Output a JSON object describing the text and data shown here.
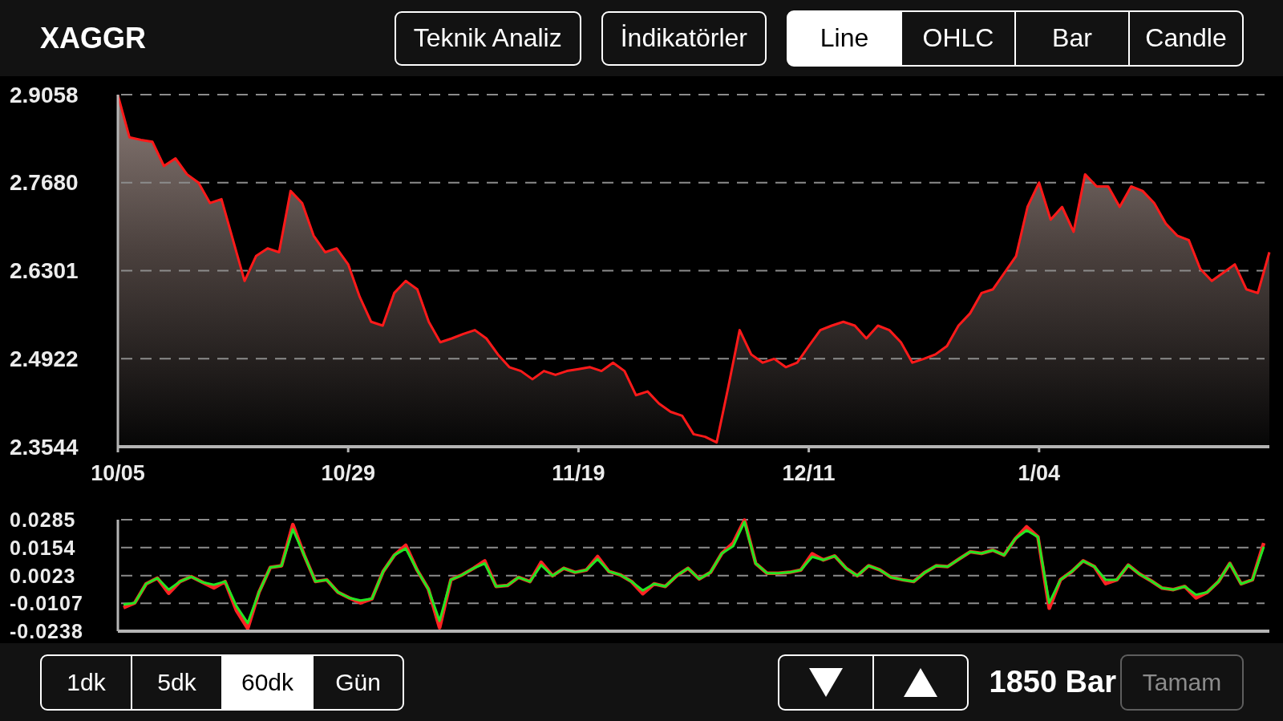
{
  "header": {
    "symbol": "XAGGR",
    "buttons": [
      "Teknik Analiz",
      "İndikatörler"
    ],
    "chart_types": [
      {
        "label": "Line",
        "selected": true
      },
      {
        "label": "OHLC",
        "selected": false
      },
      {
        "label": "Bar",
        "selected": false
      },
      {
        "label": "Candle",
        "selected": false
      }
    ]
  },
  "price_chart": {
    "chart_data": {
      "type": "area",
      "grid": true,
      "categories": [
        "10/05",
        null,
        null,
        null,
        null,
        null,
        null,
        null,
        null,
        null,
        null,
        null,
        null,
        null,
        null,
        null,
        null,
        null,
        null,
        null,
        "10/29",
        null,
        null,
        null,
        null,
        null,
        null,
        null,
        null,
        null,
        null,
        null,
        null,
        null,
        null,
        null,
        null,
        null,
        null,
        null,
        "11/19",
        null,
        null,
        null,
        null,
        null,
        null,
        null,
        null,
        null,
        null,
        null,
        null,
        null,
        null,
        null,
        null,
        null,
        null,
        null,
        "12/11",
        null,
        null,
        null,
        null,
        null,
        null,
        null,
        null,
        null,
        null,
        null,
        null,
        null,
        null,
        null,
        null,
        null,
        null,
        null,
        "1/04",
        null,
        null,
        null,
        null,
        null,
        null,
        null,
        null,
        null,
        null,
        null,
        null,
        null,
        null,
        null,
        null,
        null,
        null,
        null,
        null
      ],
      "ylim": [
        2.3544,
        2.9058
      ],
      "yticks": [
        2.9058,
        {
          "value": 2.768,
          "label": "2.7680"
        },
        2.6301,
        2.4922,
        2.3544
      ],
      "series": [
        {
          "color": "#ff1a1a",
          "values": [
            2.905,
            2.839,
            2.835,
            2.832,
            2.794,
            2.806,
            2.781,
            2.768,
            2.736,
            2.742,
            2.678,
            2.614,
            2.653,
            2.665,
            2.659,
            2.755,
            2.736,
            2.685,
            2.659,
            2.665,
            2.64,
            2.589,
            2.55,
            2.544,
            2.595,
            2.614,
            2.601,
            2.55,
            2.518,
            2.524,
            2.531,
            2.537,
            2.524,
            2.499,
            2.479,
            2.473,
            2.46,
            2.473,
            2.467,
            2.473,
            2.476,
            2.479,
            2.473,
            2.486,
            2.473,
            2.435,
            2.441,
            2.422,
            2.409,
            2.403,
            2.374,
            2.37,
            2.361,
            2.447,
            2.537,
            2.499,
            2.486,
            2.492,
            2.479,
            2.486,
            2.512,
            2.537,
            2.544,
            2.55,
            2.544,
            2.524,
            2.544,
            2.537,
            2.518,
            2.486,
            2.492,
            2.499,
            2.512,
            2.544,
            2.563,
            2.595,
            2.601,
            2.627,
            2.653,
            2.73,
            2.768,
            2.71,
            2.73,
            2.691,
            2.781,
            2.762,
            2.762,
            2.73,
            2.762,
            2.755,
            2.736,
            2.704,
            2.685,
            2.678,
            2.633,
            2.614,
            2.627,
            2.64,
            2.601,
            2.595,
            2.659
          ]
        }
      ]
    }
  },
  "indicator_chart": {
    "chart_data": {
      "type": "line",
      "grid": true,
      "categories": [
        null,
        null,
        null,
        null,
        null,
        null,
        null,
        null,
        null,
        null,
        null,
        null,
        null,
        null,
        null,
        null,
        null,
        null,
        null,
        null,
        null,
        null,
        null,
        null,
        null,
        null,
        null,
        null,
        null,
        null,
        null,
        null,
        null,
        null,
        null,
        null,
        null,
        null,
        null,
        null,
        null,
        null,
        null,
        null,
        null,
        null,
        null,
        null,
        null,
        null,
        null,
        null,
        null,
        null,
        null,
        null,
        null,
        null,
        null,
        null,
        null,
        null,
        null,
        null,
        null,
        null,
        null,
        null,
        null,
        null,
        null,
        null,
        null,
        null,
        null,
        null,
        null,
        null,
        null,
        null,
        null,
        null,
        null,
        null,
        null,
        null,
        null,
        null,
        null,
        null,
        null,
        null,
        null,
        null,
        null,
        null,
        null,
        null,
        null,
        null,
        null,
        null
      ],
      "ylim": [
        -0.0238,
        0.0285
      ],
      "yticks": [
        0.0285,
        0.0154,
        0.0023,
        -0.0107,
        -0.0238
      ],
      "series": [
        {
          "color": "#ff2424",
          "values": [
            -0.0128,
            -0.0105,
            -0.0016,
            0.0011,
            -0.006,
            -0.0005,
            0.0018,
            -0.0009,
            -0.0035,
            -0.0005,
            -0.014,
            -0.0225,
            -0.0055,
            0.0061,
            0.0069,
            0.0262,
            0.0119,
            -0.0005,
            0.0003,
            -0.0055,
            -0.0082,
            -0.0105,
            -0.0086,
            0.0042,
            0.0119,
            0.0165,
            0.0049,
            -0.004,
            -0.0222,
            0.0003,
            0.0026,
            0.0057,
            0.0092,
            -0.0028,
            -0.0024,
            0.0015,
            -0.0005,
            0.0085,
            0.0022,
            0.0057,
            0.0038,
            0.0049,
            0.0112,
            0.0042,
            0.0026,
            -0.0005,
            -0.0062,
            -0.0016,
            -0.0028,
            0.0022,
            0.0057,
            0.0007,
            0.0038,
            0.0127,
            0.0175,
            0.0283,
            0.008,
            0.0034,
            0.0034,
            0.0038,
            0.0049,
            0.0125,
            0.0096,
            0.0115,
            0.0057,
            0.0022,
            0.0069,
            0.0049,
            0.0015,
            0.0003,
            -0.0005,
            0.0038,
            0.0069,
            0.0065,
            0.01,
            0.0134,
            0.0127,
            0.0142,
            0.0119,
            0.0196,
            0.0252,
            0.0204,
            -0.013,
            0.0003,
            0.0042,
            0.0092,
            0.0065,
            -0.0015,
            0.0003,
            0.0072,
            0.003,
            -0.0001,
            -0.0036,
            -0.0043,
            -0.0028,
            -0.0082,
            -0.0055,
            -0.0005,
            0.008,
            -0.0016,
            0.0003,
            0.0175
          ]
        },
        {
          "color": "#22e622",
          "values": [
            -0.0113,
            -0.0105,
            -0.0016,
            0.0011,
            -0.0043,
            -0.0005,
            0.0018,
            -0.0009,
            -0.002,
            -0.0005,
            -0.012,
            -0.02,
            -0.0055,
            0.0061,
            0.0069,
            0.024,
            0.0119,
            -0.0005,
            0.0003,
            -0.0055,
            -0.0082,
            -0.0094,
            -0.0086,
            0.0042,
            0.0119,
            0.015,
            0.0049,
            -0.004,
            -0.019,
            0.0003,
            0.0026,
            0.0057,
            0.008,
            -0.0028,
            -0.0024,
            0.0015,
            -0.0005,
            0.0072,
            0.0022,
            0.0057,
            0.0038,
            0.0049,
            0.01,
            0.0042,
            0.0026,
            -0.0005,
            -0.0047,
            -0.0016,
            -0.0028,
            0.0022,
            0.0057,
            0.0007,
            0.0038,
            0.0127,
            0.0161,
            0.0275,
            0.008,
            0.0034,
            0.0034,
            0.0038,
            0.0049,
            0.0111,
            0.0096,
            0.0115,
            0.0057,
            0.0022,
            0.0069,
            0.0049,
            0.0015,
            0.0003,
            -0.0005,
            0.0038,
            0.0069,
            0.0065,
            0.01,
            0.0134,
            0.0127,
            0.0142,
            0.0119,
            0.0196,
            0.0235,
            0.0204,
            -0.0105,
            0.0003,
            0.0042,
            0.0092,
            0.0065,
            0.0003,
            0.0003,
            0.0072,
            0.003,
            -0.0001,
            -0.0036,
            -0.0043,
            -0.0028,
            -0.0067,
            -0.0055,
            -0.0005,
            0.008,
            -0.0016,
            0.0003,
            0.0158
          ]
        }
      ]
    }
  },
  "footer": {
    "intervals": [
      {
        "label": "1dk",
        "selected": false
      },
      {
        "label": "5dk",
        "selected": false
      },
      {
        "label": "60dk",
        "selected": true
      },
      {
        "label": "Gün",
        "selected": false
      }
    ],
    "bar_count": "1850 Bar",
    "confirm_button": {
      "label": "Tamam",
      "disabled": true
    }
  }
}
